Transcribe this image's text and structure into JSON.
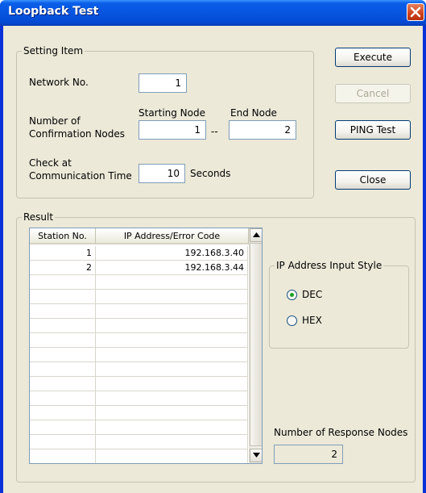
{
  "window": {
    "title": "Loopback Test"
  },
  "setting_item": {
    "legend": "Setting Item",
    "network_no_label": "Network No.",
    "network_no_value": "1",
    "starting_node_label": "Starting Node",
    "end_node_label": "End Node",
    "confirm_nodes_label_1": "Number of",
    "confirm_nodes_label_2": "Confirmation Nodes",
    "starting_node_value": "1",
    "separator": "--",
    "end_node_value": "2",
    "check_label_1": "Check at",
    "check_label_2": "Communication Time",
    "check_value": "10",
    "seconds_label": "Seconds"
  },
  "buttons": {
    "execute": "Execute",
    "cancel": "Cancel",
    "ping": "PING Test",
    "close": "Close"
  },
  "result": {
    "legend": "Result",
    "columns": [
      "Station No.",
      "IP Address/Error Code"
    ],
    "rows": [
      [
        "1",
        "192.168.3.40"
      ],
      [
        "2",
        "192.168.3.44"
      ]
    ],
    "ip_style_legend": "IP Address Input Style",
    "radio_dec": "DEC",
    "radio_hex": "HEX",
    "selected_style": "DEC",
    "response_nodes_label": "Number of Response Nodes",
    "response_nodes_value": "2"
  },
  "icons": {
    "close": "close-icon",
    "scroll_up": "triangle-up-icon",
    "scroll_down": "triangle-down-icon"
  }
}
